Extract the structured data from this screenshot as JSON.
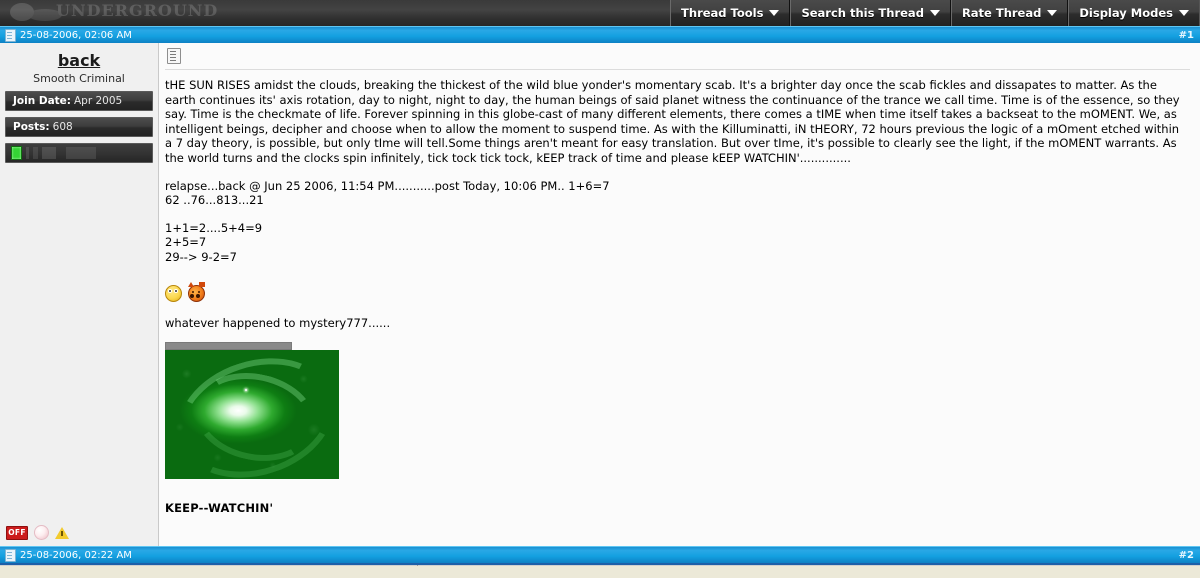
{
  "header": {
    "logo_text": "UNDERGROUND",
    "toolbar": [
      {
        "label": "Thread Tools",
        "icon": "chevron-down-icon"
      },
      {
        "label": "Search this Thread",
        "icon": "chevron-down-icon"
      },
      {
        "label": "Rate Thread",
        "icon": "chevron-down-icon"
      },
      {
        "label": "Display Modes",
        "icon": "chevron-down-icon"
      }
    ]
  },
  "posts": [
    {
      "timestamp": "25-08-2006, 02:06 AM",
      "number": "#1",
      "post_icon": "post-document-icon",
      "user": {
        "name": "back",
        "title": "Smooth Criminal",
        "join_date_label": "Join Date:",
        "join_date_value": "Apr 2005",
        "posts_label": "Posts:",
        "posts_value": "608",
        "reputation_icon": "green-reputation-icon",
        "status_icon": "offline-badge",
        "status_text": "OFF",
        "pm_icon": "private-message-icon",
        "report_icon": "report-warning-icon"
      },
      "body": {
        "paragraph1": "tHE SUN RISES amidst the clouds, breaking the thickest of the wild blue yonder's momentary scab. It's a brighter day once the scab fickles and dissapates to matter. As the earth continues its' axis rotation, day to night, night to day, the human beings of said planet witness the continuance of the trance we call time. Time is of the essence, so they say. Time is the checkmate of life. Forever spinning in this globe-cast of many different elements, there comes a tIME when time itself takes a backseat to the mOMENT. We, as intelligent beings, decipher and choose when to allow the moment to suspend time. As with the Killuminatti, iN tHEORY, 72 hours previous the logic of a mOment etched within a 7 day theory, is possible, but only tIme will tell.Some things aren't meant for easy translation. But over tIme, it's possible to clearly see the light, if the mOMENT warrants. As the world turns and the clocks spin infinitely, tick tock tick tock, kEEP track of time and please kEEP WATCHIN'..............",
        "paragraph2": "relapse...back @ Jun 25 2006, 11:54 PM...........post Today, 10:06 PM.. 1+6=7\n62 ..76...813...21",
        "paragraph3": "1+1=2....5+4=9\n2+5=7\n29--> 9-2=7",
        "smilies": [
          {
            "name": "rolleyes-smiley"
          },
          {
            "name": "devil-smiley"
          }
        ],
        "paragraph4": "whatever happened to mystery777......",
        "attachment": {
          "name": "green-galaxy-image",
          "alt": "green galaxy photo"
        },
        "signature": "KEEP--WATCHIN'"
      }
    },
    {
      "timestamp": "25-08-2006, 02:22 AM",
      "number": "#2",
      "post_icon": "post-document-icon"
    }
  ],
  "colors": {
    "header_bar": "#2f2f2f",
    "post_header_blue": "#13a0e0",
    "accent_rule": "#1d5fa8",
    "page_background": "#ece9d8"
  }
}
